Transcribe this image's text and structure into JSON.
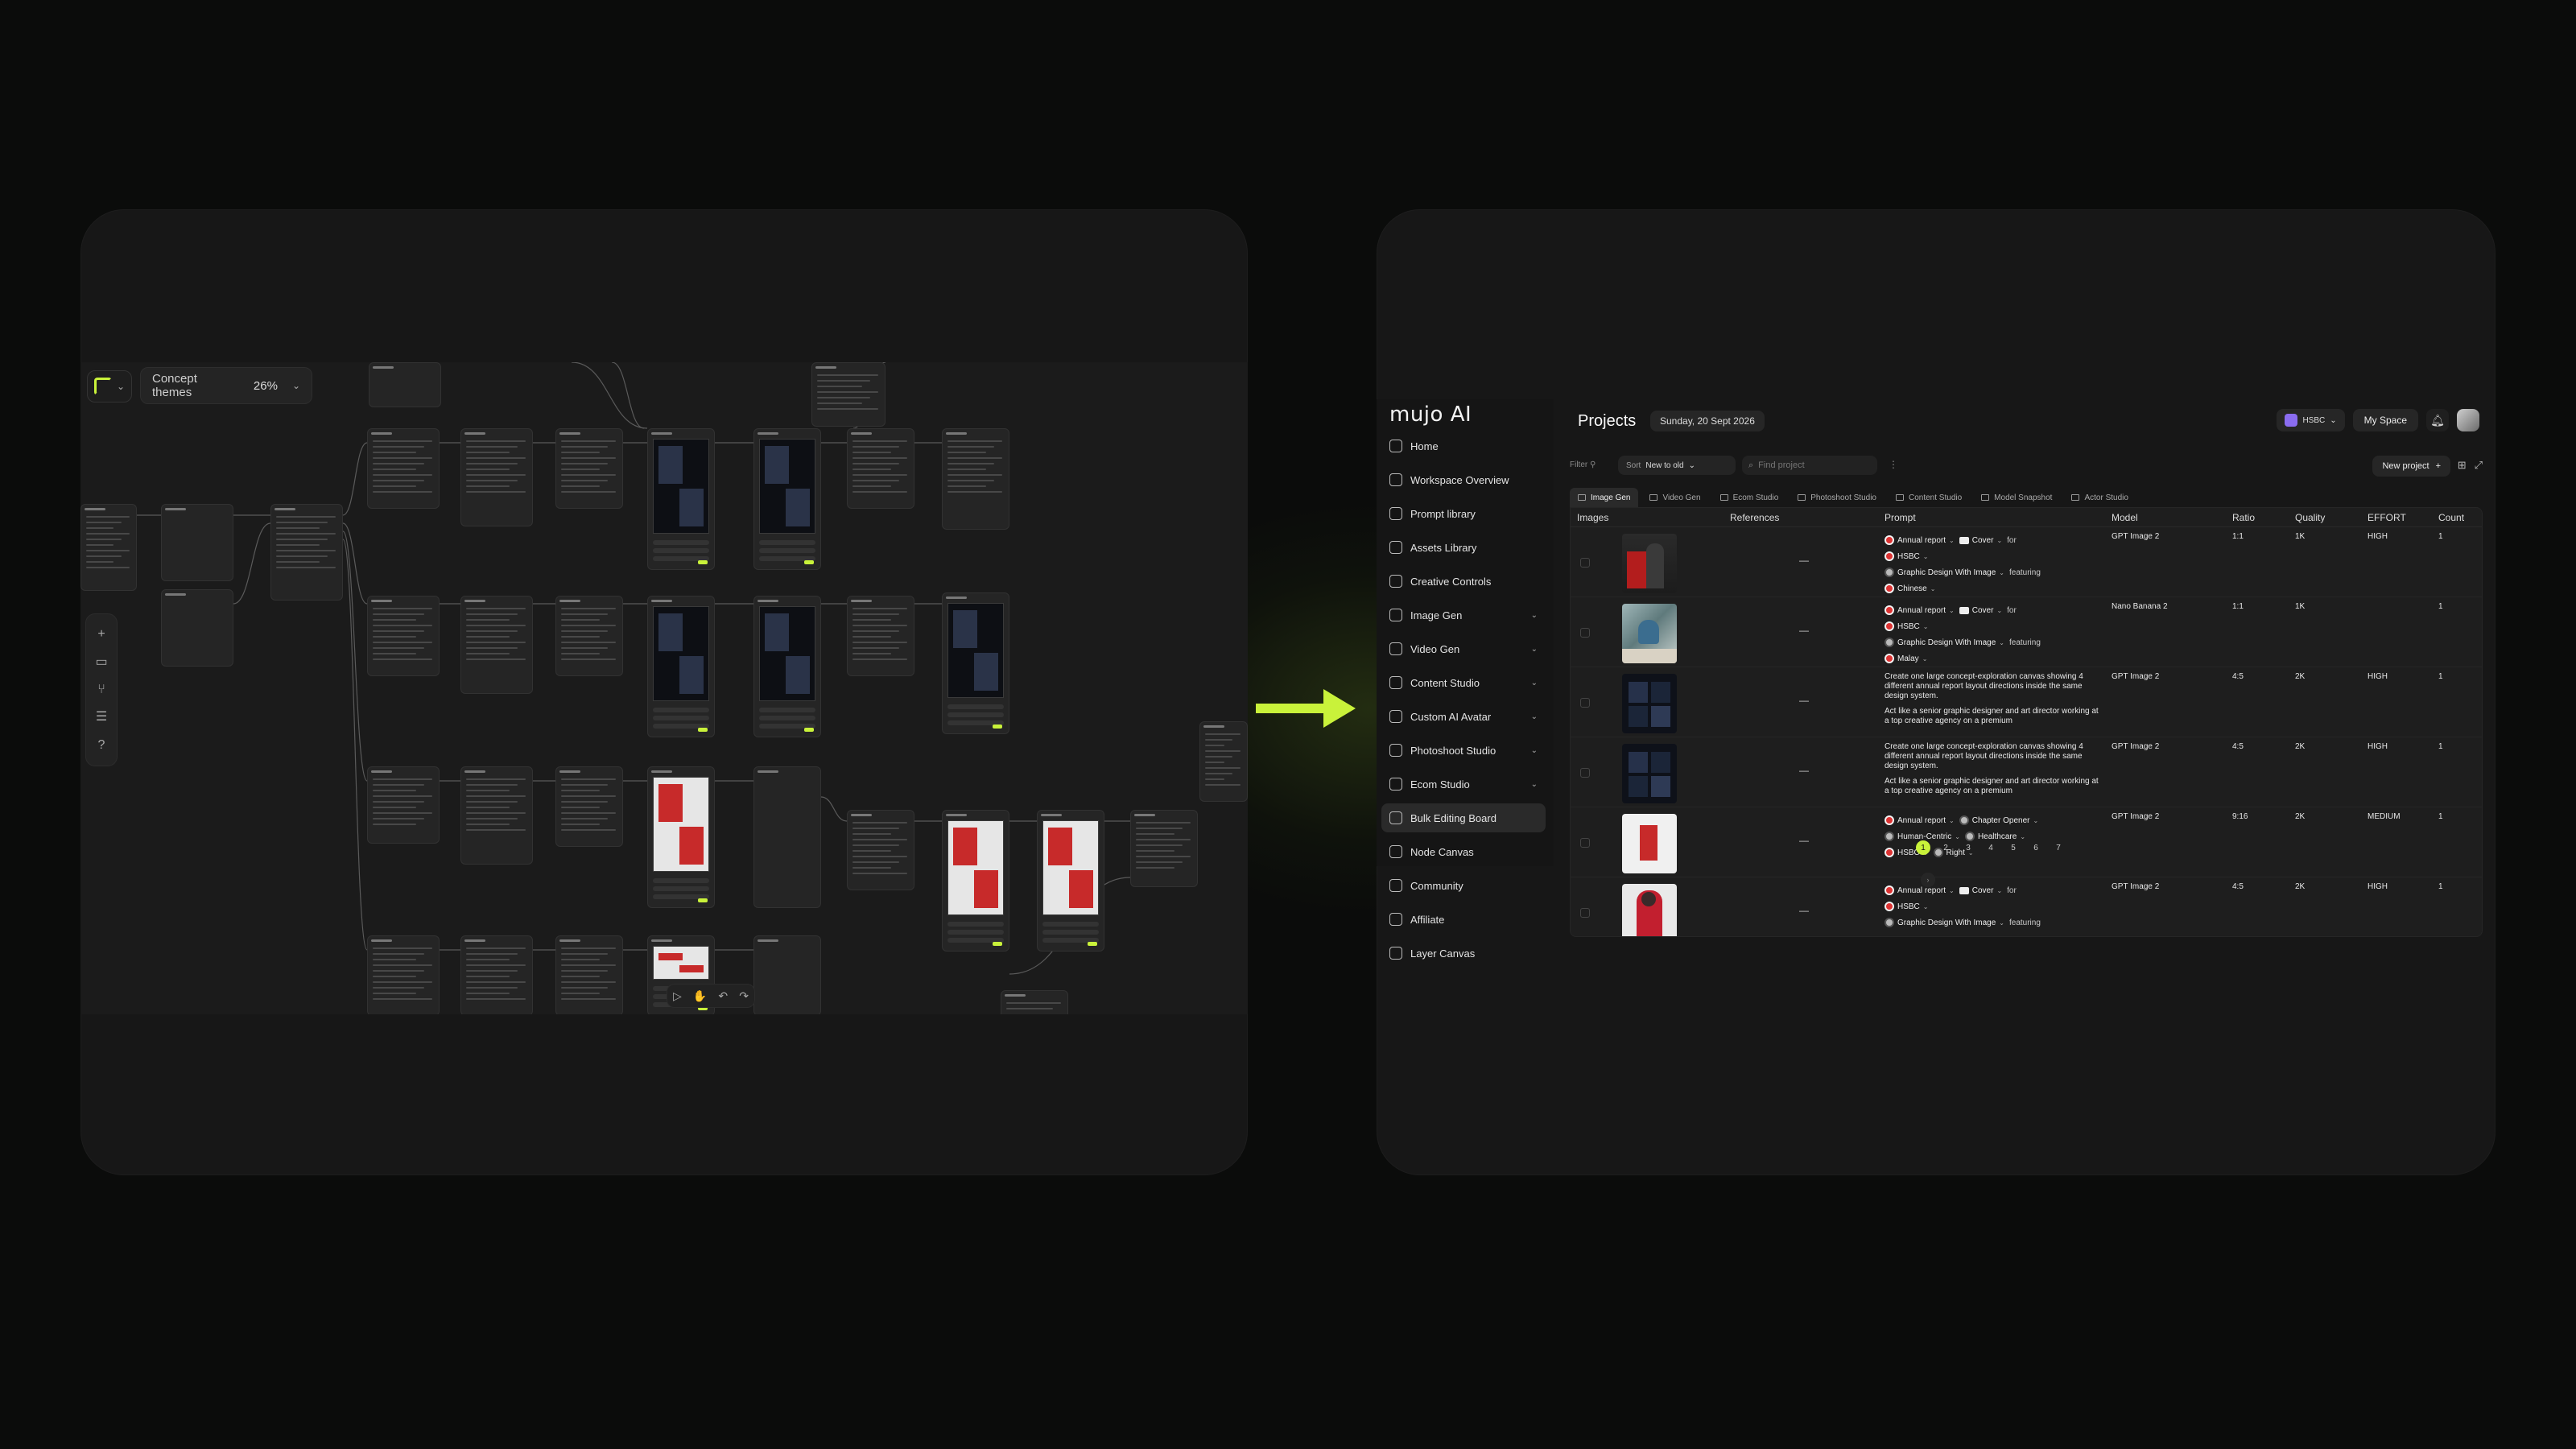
{
  "canvas": {
    "theme_label": "Concept themes",
    "zoom": "26%"
  },
  "app": {
    "brand": "mujo AI",
    "nav": [
      {
        "label": "Home"
      },
      {
        "label": "Workspace Overview"
      },
      {
        "label": "Prompt library"
      },
      {
        "label": "Assets Library"
      },
      {
        "label": "Creative Controls"
      },
      {
        "label": "Image Gen",
        "expandable": true
      },
      {
        "label": "Video Gen",
        "expandable": true
      },
      {
        "label": "Content Studio",
        "expandable": true
      },
      {
        "label": "Custom AI Avatar",
        "expandable": true
      },
      {
        "label": "Photoshoot Studio",
        "expandable": true
      },
      {
        "label": "Ecom Studio",
        "expandable": true
      },
      {
        "label": "Bulk Editing Board",
        "active": true
      },
      {
        "label": "Node Canvas"
      },
      {
        "label": "Community"
      },
      {
        "label": "Affiliate"
      },
      {
        "label": "Layer Canvas"
      }
    ],
    "header": {
      "title": "Projects",
      "date": "Sunday, 20 Sept 2026",
      "org": "HSBC",
      "space": "My Space"
    },
    "filters": {
      "filter_label": "Filter",
      "sort_key": "Sort",
      "sort_value": "New to old",
      "search_placeholder": "Find project",
      "new_project": "New project"
    },
    "tabs": [
      "Image Gen",
      "Video Gen",
      "Ecom Studio",
      "Photoshoot Studio",
      "Content Studio",
      "Model Snapshot",
      "Actor Studio"
    ],
    "columns": [
      "Images",
      "References",
      "Prompt",
      "Model",
      "Ratio",
      "Quality",
      "EFFORT",
      "Count"
    ],
    "rows": [
      {
        "ref": "—",
        "model": "GPT Image 2",
        "ratio": "1:1",
        "quality": "1K",
        "effort": "HIGH",
        "count": "1",
        "p": {
          "a": "Annual report",
          "b": "Cover",
          "c": "for",
          "d": "HSBC",
          "e": "Graphic Design With Image",
          "f": "featuring",
          "g": "Chinese"
        }
      },
      {
        "ref": "—",
        "model": "Nano Banana 2",
        "ratio": "1:1",
        "quality": "1K",
        "effort": "",
        "count": "1",
        "p": {
          "a": "Annual report",
          "b": "Cover",
          "c": "for",
          "d": "HSBC",
          "e": "Graphic Design With Image",
          "f": "featuring",
          "g": "Malay"
        }
      },
      {
        "ref": "—",
        "model": "GPT Image 2",
        "ratio": "4:5",
        "quality": "2K",
        "effort": "HIGH",
        "count": "1",
        "text1": "Create one large concept-exploration canvas showing 4 different annual report layout directions inside the same design system.",
        "text2": "Act like a senior graphic designer and art director working at a top creative agency on a premium"
      },
      {
        "ref": "—",
        "model": "GPT Image 2",
        "ratio": "4:5",
        "quality": "2K",
        "effort": "HIGH",
        "count": "1",
        "text1": "Create one large concept-exploration canvas showing 4 different annual report layout directions inside the same design system.",
        "text2": "Act like a senior graphic designer and art director working at a top creative agency on a premium"
      },
      {
        "ref": "—",
        "model": "GPT Image 2",
        "ratio": "9:16",
        "quality": "2K",
        "effort": "MEDIUM",
        "count": "1",
        "p": {
          "a": "Annual report",
          "b": "Chapter Opener",
          "c": "Human-Centric",
          "d": "Healthcare",
          "e": "HSBC",
          "f": "Right"
        }
      },
      {
        "ref": "—",
        "model": "GPT Image 2",
        "ratio": "4:5",
        "quality": "2K",
        "effort": "HIGH",
        "count": "1",
        "p": {
          "a": "Annual report",
          "b": "Cover",
          "c": "for",
          "d": "HSBC",
          "e": "Graphic Design With Image",
          "f": "featuring"
        }
      }
    ],
    "pages": [
      "1",
      "2",
      "3",
      "4",
      "5",
      "6",
      "7"
    ],
    "current_page": "1"
  },
  "colors": {
    "accent": "#c9f23a",
    "background": "#0b0c0b",
    "panel": "#171717"
  }
}
